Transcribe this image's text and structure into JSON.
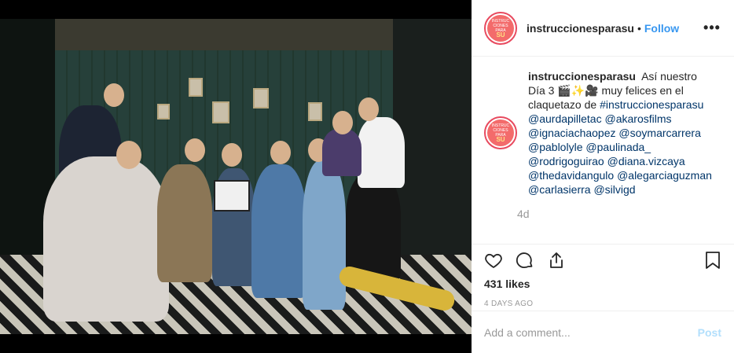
{
  "post": {
    "username": "instruccionesparasu",
    "separator": "•",
    "follow_label": "Follow",
    "more_icon": "more-dots-icon",
    "avatar_lines": [
      "INSTRUC",
      "CIONES",
      "PARA"
    ],
    "avatar_brand": "SU",
    "avatar_color": "#f36b6b",
    "caption_text_1": "Así nuestro Día 3",
    "caption_emoji": "🎬✨🎥",
    "caption_text_2": "muy felices en el claquetazo de",
    "hashtag": "#instruccionesparasu",
    "mentions": [
      "@aurdapilletac",
      "@akarosfilms",
      "@ignaciachaopez",
      "@soymarcarrera",
      "@pablolyle",
      "@paulinada_",
      "@rodrigoguirao",
      "@diana.vizcaya",
      "@thedavidangulo",
      "@alegarciaguzman",
      "@carlasierra",
      "@silvigd"
    ],
    "time_ago": "4d",
    "likes": "431 likes",
    "date": "4 DAYS AGO",
    "comment_placeholder": "Add a comment...",
    "post_label": "Post",
    "accent_color": "#3897f0"
  }
}
